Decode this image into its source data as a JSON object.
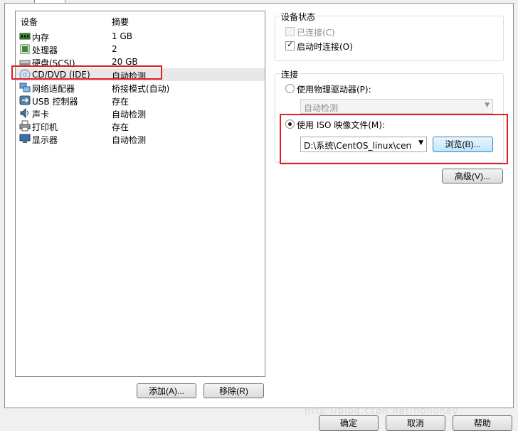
{
  "devices": {
    "header": {
      "device": "设备",
      "summary": "摘要"
    },
    "items": [
      {
        "name": "内存",
        "summary": "1 GB",
        "icon": "memory-icon"
      },
      {
        "name": "处理器",
        "summary": "2",
        "icon": "processor-icon"
      },
      {
        "name": "硬盘(SCSI)",
        "summary": "20 GB",
        "icon": "hard-disk-icon"
      },
      {
        "name": "CD/DVD (IDE)",
        "summary": "自动检测",
        "icon": "cd-dvd-icon"
      },
      {
        "name": "网络适配器",
        "summary": "桥接模式(自动)",
        "icon": "network-adapter-icon"
      },
      {
        "name": "USB 控制器",
        "summary": "存在",
        "icon": "usb-icon"
      },
      {
        "name": "声卡",
        "summary": "自动检测",
        "icon": "sound-card-icon"
      },
      {
        "name": "打印机",
        "summary": "存在",
        "icon": "printer-icon"
      },
      {
        "name": "显示器",
        "summary": "自动检测",
        "icon": "display-icon"
      }
    ],
    "add_label": "添加(A)...",
    "remove_label": "移除(R)"
  },
  "device_status": {
    "title": "设备状态",
    "connected_label": "已连接(C)",
    "connect_on_power_label": "启动时连接(O)"
  },
  "connection": {
    "title": "连接",
    "physical_label": "使用物理驱动器(P):",
    "physical_value": "自动检测",
    "iso_label": "使用 ISO 映像文件(M):",
    "iso_value": "D:\\系统\\CentOS_linux\\cent(",
    "browse_label": "浏览(B)..."
  },
  "advanced_label": "高级(V)...",
  "footer": {
    "ok": "确定",
    "cancel": "取消",
    "help": "帮助"
  },
  "watermark": "http://blog.csdn.net/nohoney",
  "colors": {
    "highlight_border": "#e02020"
  }
}
